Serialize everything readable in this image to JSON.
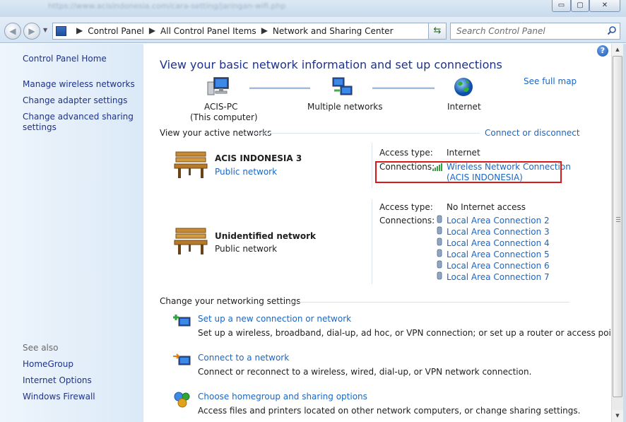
{
  "titlebar": {
    "url_text": "https://www.acisindonesia.com/cara-setting/jaringan-wifi.php",
    "minimize_glyph": "▭",
    "maximize_glyph": "▢",
    "close_glyph": "✕"
  },
  "address_bar": {
    "breadcrumbs": [
      "Control Panel",
      "All Control Panel Items",
      "Network and Sharing Center"
    ],
    "search_placeholder": "Search Control Panel"
  },
  "left_pane": {
    "home": "Control Panel Home",
    "tasks": [
      "Manage wireless networks",
      "Change adapter settings",
      "Change advanced sharing",
      "settings"
    ],
    "see_also_title": "See also",
    "see_also": [
      "HomeGroup",
      "Internet Options",
      "Windows Firewall"
    ]
  },
  "main": {
    "title": "View your basic network information and set up connections",
    "see_full_map": "See full map",
    "map": {
      "computer_name": "ACIS-PC",
      "computer_sub": "(This computer)",
      "middle": "Multiple networks",
      "internet": "Internet"
    },
    "active_networks_title": "View your active networks",
    "connect_or_disconnect": "Connect or disconnect",
    "networks": [
      {
        "name": "ACIS INDONESIA  3",
        "type": "Public network",
        "access_label": "Access type:",
        "access_value": "Internet",
        "connections_label": "Connections:",
        "connections": [
          "Wireless Network Connection",
          "(ACIS INDONESIA)"
        ]
      },
      {
        "name": "Unidentified network",
        "type": "Public network",
        "access_label": "Access type:",
        "access_value": "No Internet access",
        "connections_label": "Connections:",
        "connections": [
          "Local Area Connection 2",
          "Local Area Connection 3",
          "Local Area Connection 4",
          "Local Area Connection 5",
          "Local Area Connection 6",
          "Local Area Connection 7"
        ]
      }
    ],
    "settings_title": "Change your networking settings",
    "settings": [
      {
        "link": "Set up a new connection or network",
        "desc": "Set up a wireless, broadband, dial-up, ad hoc, or VPN connection; or set up a router or access point."
      },
      {
        "link": "Connect to a network",
        "desc": "Connect or reconnect to a wireless, wired, dial-up, or VPN network connection."
      },
      {
        "link": "Choose homegroup and sharing options",
        "desc": "Access files and printers located on other network computers, or change sharing settings."
      }
    ]
  },
  "colors": {
    "link": "#1a66c4",
    "heading": "#1e3287",
    "highlight_border": "#d91818",
    "left_pane_bg": "#dbe9f7"
  },
  "icons": [
    "back-arrow-icon",
    "forward-arrow-icon",
    "refresh-icon",
    "search-icon",
    "help-icon",
    "computer-icon",
    "network-icon",
    "globe-icon",
    "bench-icon",
    "signal-bars-icon",
    "ethernet-plug-icon",
    "new-connection-icon",
    "connect-network-icon",
    "homegroup-icon"
  ]
}
